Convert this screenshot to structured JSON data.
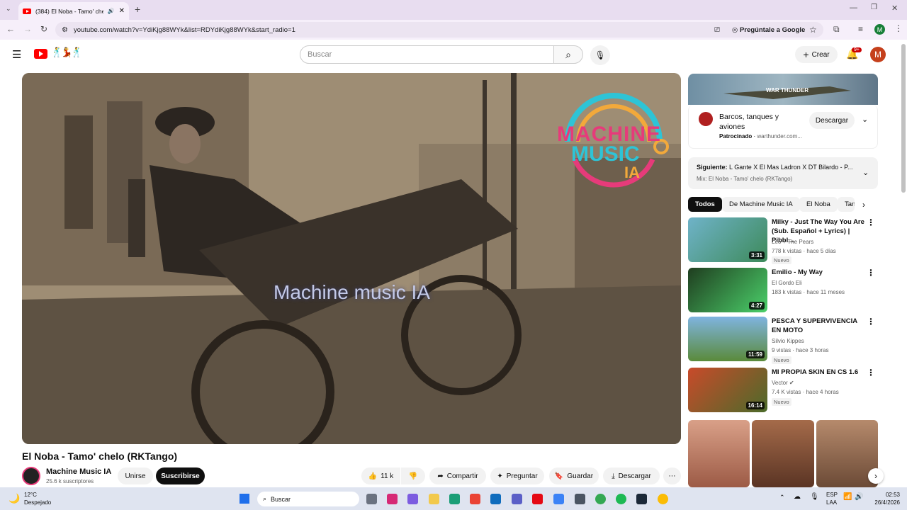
{
  "browser": {
    "tab_title": "(384) El Noba - Tamo' chelo",
    "url": "youtube.com/watch?v=YdiKjg88WYk&list=RDYdiKjg88WYk&start_radio=1",
    "ask_google": "Pregúntale a Google",
    "profile_initial": "M"
  },
  "header": {
    "search_placeholder": "Buscar",
    "create_label": "Crear",
    "notif_count": "9+",
    "avatar_initial": "M"
  },
  "video": {
    "overlay_text": "Machine music IA",
    "logo_line1": "MACHINE",
    "logo_line2": "MUSIC",
    "logo_line3": "IA",
    "title": "El Noba - Tamo' chelo (RKTango)",
    "channel": "Machine Music IA",
    "subscribers": "25.6 k suscriptores",
    "join": "Unirse",
    "subscribe": "Suscribirse",
    "likes": "11 k",
    "share": "Compartir",
    "ask": "Preguntar",
    "save": "Guardar",
    "download": "Descargar"
  },
  "ad": {
    "title": "Barcos, tanques y aviones",
    "sponsored": "Patrocinado",
    "domain": "warthunder.com...",
    "button": "Descargar"
  },
  "next": {
    "label": "Siguiente:",
    "title": "L Gante X El Mas Ladron X DT Bilardo - P...",
    "mix": "Mix: El Noba - Tamo' chelo (RKTango)"
  },
  "chips": [
    "Todos",
    "De Machine Music IA",
    "El Noba",
    "Tan"
  ],
  "recommendations": [
    {
      "title": "Milky - Just The Way You Are (Sub. Español + Lyrics) | Pibbl...",
      "channel": "Leo + The Pears",
      "meta": "778 k vistas · hace 5 días",
      "badge": "Nuevo",
      "duration": "3:31"
    },
    {
      "title": "Emilio - My Way",
      "channel": "El Gordo Eli",
      "meta": "183 k vistas · hace 11 meses",
      "badge": "",
      "duration": "4:27"
    },
    {
      "title": "PESCA Y SUPERVIVENCIA EN MOTO",
      "channel": "Silvio Kippes",
      "meta": "9 vistas · hace 3 horas",
      "badge": "Nuevo",
      "duration": "11:59"
    },
    {
      "title": "MI PROPIA SKIN EN CS 1.6",
      "channel": "Vector",
      "meta": "7.4 K vistas · hace 4 horas",
      "badge": "Nuevo",
      "duration": "16:14"
    }
  ],
  "taskbar": {
    "weather_temp": "12°C",
    "weather_desc": "Despejado",
    "search": "Buscar",
    "lang1": "ESP",
    "lang2": "LAA",
    "time": "02:53",
    "date": "26/4/2026"
  }
}
